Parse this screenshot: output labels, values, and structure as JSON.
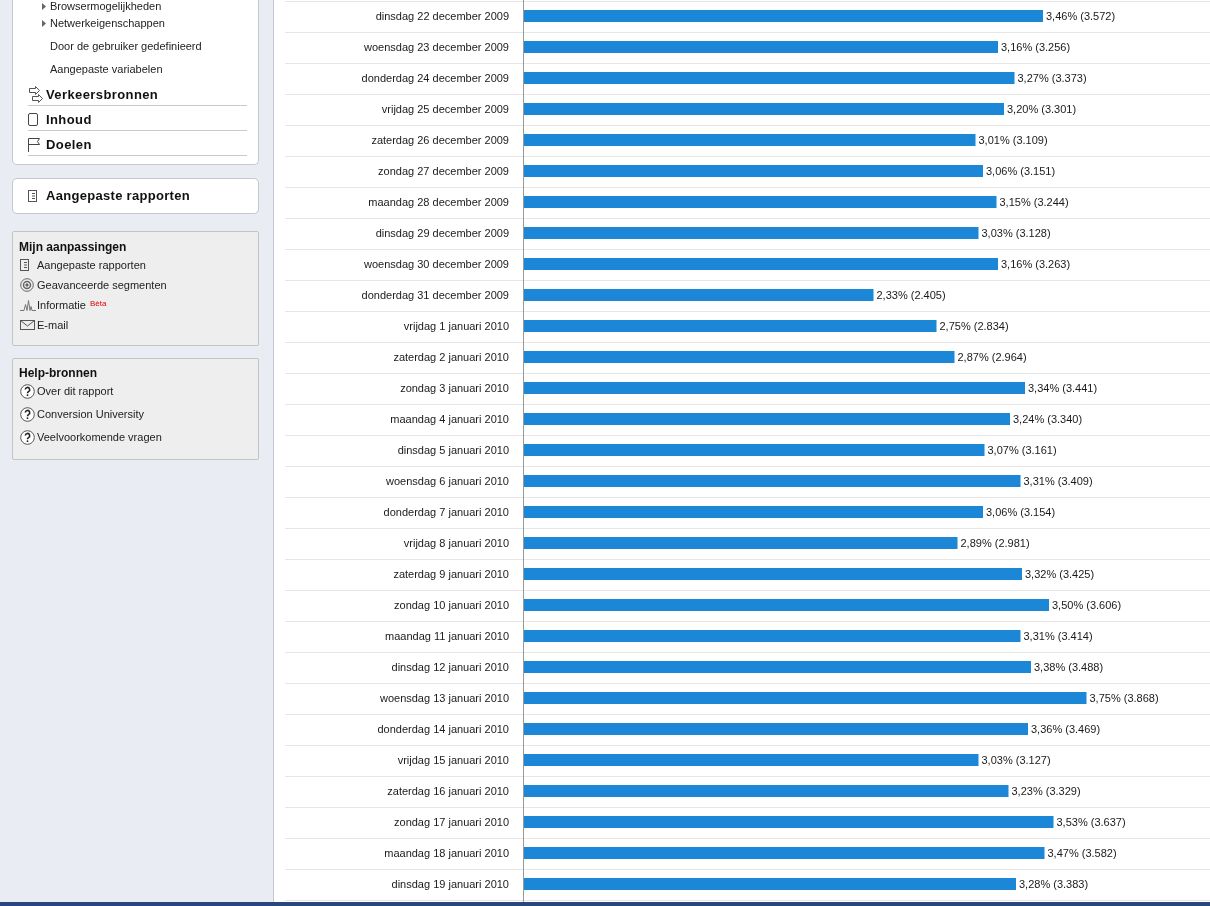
{
  "sidebar": {
    "report_menu": {
      "items": [
        {
          "label": "Browsermogelijkheden",
          "kind": "group",
          "expanded": false
        },
        {
          "label": "Netwerkeigenschappen",
          "kind": "group",
          "expanded": false
        },
        {
          "label": "Door de gebruiker gedefinieerd",
          "kind": "link"
        },
        {
          "label": "Aangepaste variabelen",
          "kind": "link"
        }
      ],
      "sections": [
        {
          "label": "Verkeersbronnen"
        },
        {
          "label": "Inhoud"
        },
        {
          "label": "Doelen"
        }
      ]
    },
    "custom_reports": {
      "label": "Aangepaste rapporten"
    },
    "panels": [
      {
        "title": "Mijn aanpassingen",
        "items": [
          {
            "label": "Aangepaste rapporten"
          },
          {
            "label": "Geavanceerde segmenten"
          },
          {
            "label": "Informatie",
            "badge": "Bèta"
          },
          {
            "label": "E-mail"
          }
        ]
      },
      {
        "title": "Help-bronnen",
        "items": [
          {
            "label": "Over dit rapport"
          },
          {
            "label": "Conversion University"
          },
          {
            "label": "Veelvoorkomende vragen"
          }
        ]
      }
    ]
  },
  "report": {
    "chart_data": {
      "type": "bar",
      "orientation": "horizontal",
      "categories": [
        "dinsdag 22 december 2009",
        "woensdag 23 december 2009",
        "donderdag 24 december 2009",
        "vrijdag 25 december 2009",
        "zaterdag 26 december 2009",
        "zondag 27 december 2009",
        "maandag 28 december 2009",
        "dinsdag 29 december 2009",
        "woensdag 30 december 2009",
        "donderdag 31 december 2009",
        "vrijdag 1 januari 2010",
        "zaterdag 2 januari 2010",
        "zondag 3 januari 2010",
        "maandag 4 januari 2010",
        "dinsdag 5 januari 2010",
        "woensdag 6 januari 2010",
        "donderdag 7 januari 2010",
        "vrijdag 8 januari 2010",
        "zaterdag 9 januari 2010",
        "zondag 10 januari 2010",
        "maandag 11 januari 2010",
        "dinsdag 12 januari 2010",
        "woensdag 13 januari 2010",
        "donderdag 14 januari 2010",
        "vrijdag 15 januari 2010",
        "zaterdag 16 januari 2010",
        "zondag 17 januari 2010",
        "maandag 18 januari 2010",
        "dinsdag 19 januari 2010"
      ],
      "values": [
        3.46,
        3.16,
        3.27,
        3.2,
        3.01,
        3.06,
        3.15,
        3.03,
        3.16,
        2.33,
        2.75,
        2.87,
        3.34,
        3.24,
        3.07,
        3.31,
        3.06,
        2.89,
        3.32,
        3.5,
        3.31,
        3.38,
        3.75,
        3.36,
        3.03,
        3.23,
        3.53,
        3.47,
        3.28
      ],
      "value_labels": [
        "3,46% (3.572)",
        "3,16% (3.256)",
        "3,27% (3.373)",
        "3,20% (3.301)",
        "3,01% (3.109)",
        "3,06% (3.151)",
        "3,15% (3.244)",
        "3,03% (3.128)",
        "3,16% (3.263)",
        "2,33% (2.405)",
        "2,75% (2.834)",
        "2,87% (2.964)",
        "3,34% (3.441)",
        "3,24% (3.340)",
        "3,07% (3.161)",
        "3,31% (3.409)",
        "3,06% (3.154)",
        "2,89% (2.981)",
        "3,32% (3.425)",
        "3,50% (3.606)",
        "3,31% (3.414)",
        "3,38% (3.488)",
        "3,75% (3.868)",
        "3,36% (3.469)",
        "3,03% (3.127)",
        "3,23% (3.329)",
        "3,53% (3.637)",
        "3,47% (3.582)",
        "3,28% (3.383)"
      ]
    }
  }
}
